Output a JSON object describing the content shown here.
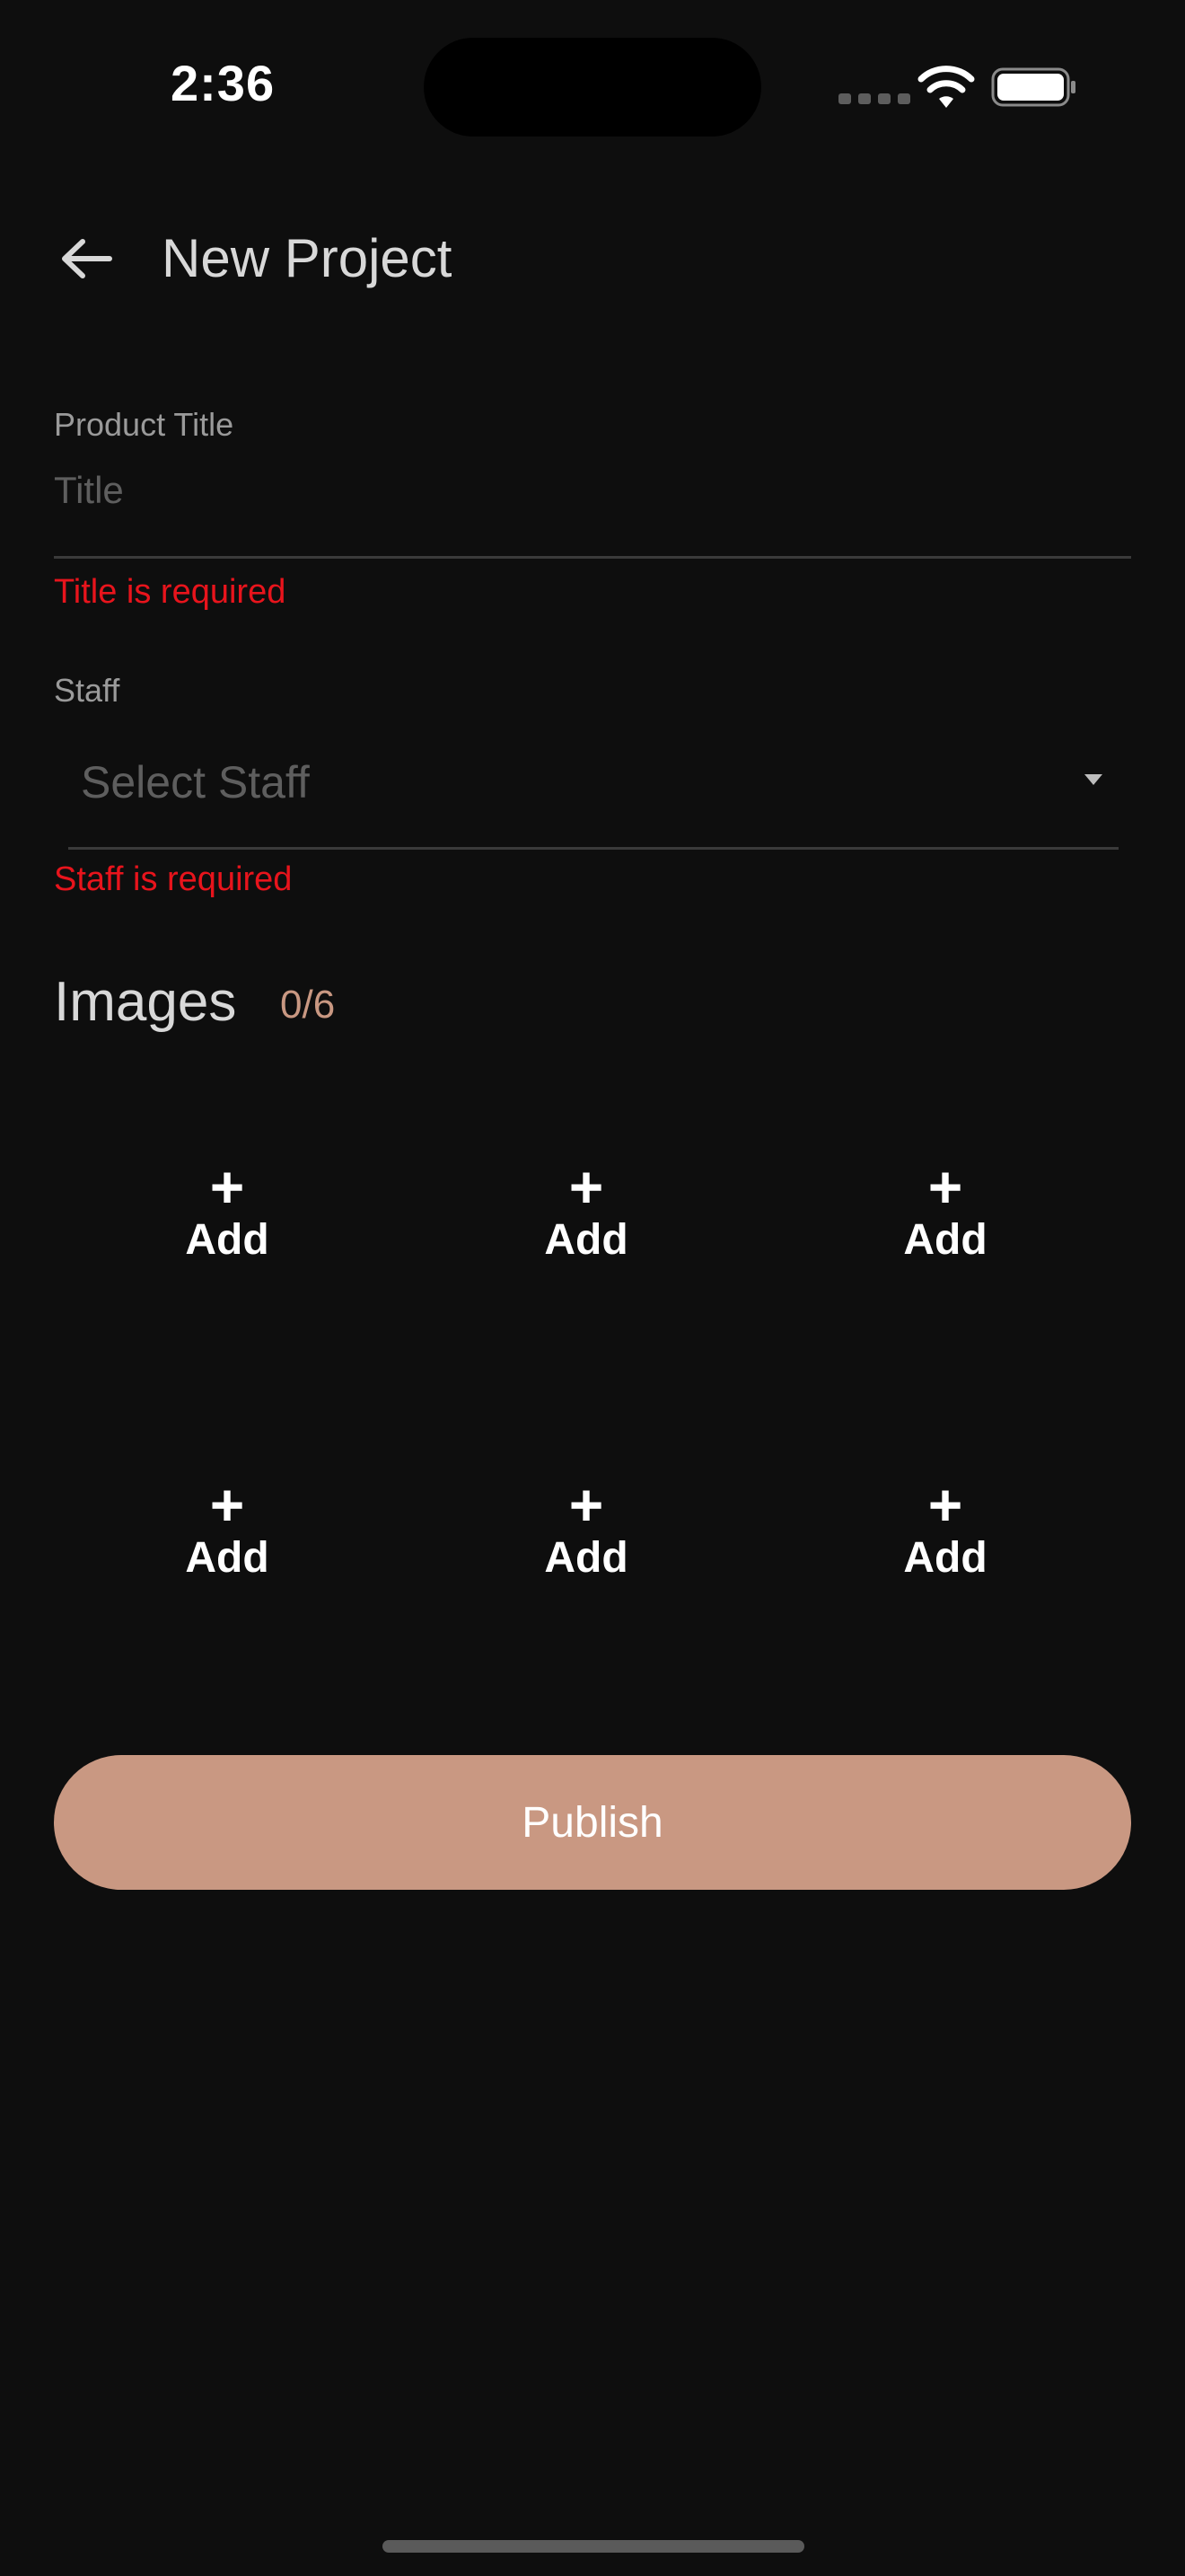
{
  "status_bar": {
    "time": "2:36"
  },
  "header": {
    "back_icon": "arrow-left-icon",
    "title": "New Project"
  },
  "form": {
    "product_title": {
      "label": "Product Title",
      "placeholder": "Title",
      "value": "",
      "error": "Title is required"
    },
    "staff": {
      "label": "Staff",
      "placeholder": "Select Staff",
      "error": "Staff is required"
    }
  },
  "images": {
    "title": "Images",
    "count": "0/6",
    "slots": [
      {
        "icon": "+",
        "label": "Add"
      },
      {
        "icon": "+",
        "label": "Add"
      },
      {
        "icon": "+",
        "label": "Add"
      },
      {
        "icon": "+",
        "label": "Add"
      },
      {
        "icon": "+",
        "label": "Add"
      },
      {
        "icon": "+",
        "label": "Add"
      }
    ]
  },
  "publish_label": "Publish",
  "colors": {
    "background": "#0e0e0e",
    "accent": "#c99882",
    "error": "#e8141c"
  }
}
